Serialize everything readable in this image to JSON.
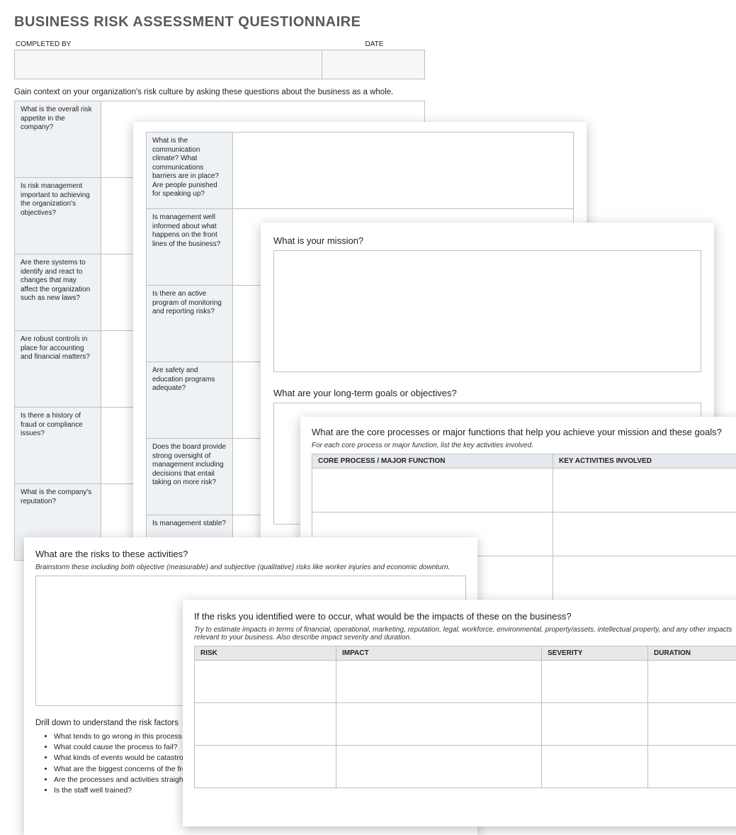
{
  "title": "BUSINESS RISK ASSESSMENT QUESTIONNAIRE",
  "completed_by": "COMPLETED BY",
  "date": "DATE",
  "context_instr": "Gain context on your organization's risk culture by asking these questions about the business as a whole.",
  "q1": [
    "What is the overall risk appetite in the company?",
    "Is risk management important to achieving the organization's objectives?",
    "Are there systems to identify and react to changes that may affect the organization such as new laws?",
    "Are robust controls in place for accounting and financial matters?",
    "Is there a history of fraud or compliance issues?",
    "What is the company's reputation?"
  ],
  "q2": [
    "What is the communication climate? What communications barriers are in place? Are people punished for speaking up?",
    "Is management well informed about what happens on the front lines of the business?",
    "Is there an active program of monitoring and reporting risks?",
    "Are safety and education programs adequate?",
    "Does the board provide strong oversight of management including decisions that entail taking on more risk?",
    "Is management stable?"
  ],
  "mission_q": "What is your mission?",
  "goals_q": "What are your long-term goals or objectives?",
  "core_q": "What are the core processes or major functions that help you achieve your mission and these goals?",
  "core_sub": "For each core process or major function, list the key activities involved.",
  "core_h1": "CORE PROCESS / MAJOR FUNCTION",
  "core_h2": "KEY ACTIVITIES INVOLVED",
  "risks_q": "What are the risks to these activities?",
  "risks_sub": "Brainstorm these including both objective (measurable) and subjective (qualitative) risks like worker injuries and economic downturn.",
  "drill": "Drill down to understand the risk factors",
  "bullets": [
    "What tends to go wrong in this process or function?",
    "What could cause the process to fail?",
    "What kinds of events would be catastrophic?",
    "What are the biggest concerns of the frontline staff?",
    "Are the processes and activities straightforward?",
    "Is the staff well trained?"
  ],
  "impacts_q": "If the risks you identified were to occur, what would be the impacts of these on the business?",
  "impacts_sub": "Try to estimate impacts in terms of financial, operational, marketing, reputation, legal, workforce, environmental, property/assets, intellectual property, and any other impacts relevant to your business. Also describe impact severity and duration.",
  "imp_h": [
    "RISK",
    "IMPACT",
    "SEVERITY",
    "DURATION"
  ]
}
